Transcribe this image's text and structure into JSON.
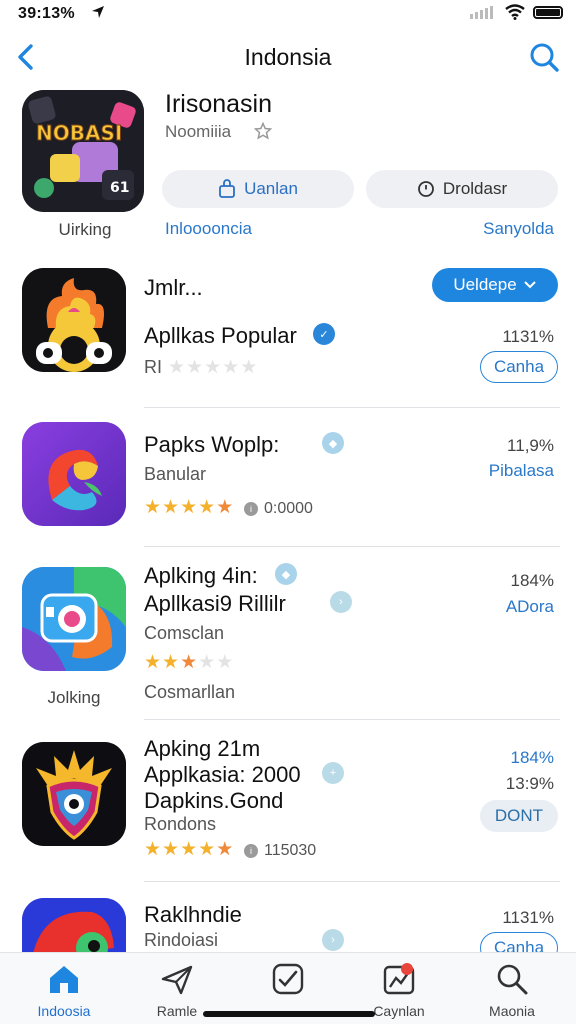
{
  "status_bar": {
    "time": "39:13%"
  },
  "nav": {
    "title": "Indonsia"
  },
  "hero": {
    "name": "Irisonasin",
    "subtitle": "Noomiiia",
    "caption": "Uirking",
    "icon_text": "NOBASI",
    "button_primary": "Uanlan",
    "button_secondary": "Droldasr",
    "link_left": "Inlooooncia",
    "link_right": "Sanyolda"
  },
  "apps": [
    {
      "title": "Jmlr...",
      "title2": "Apllkas Popular",
      "subtitle": "RI",
      "percent": "1131%",
      "action_primary": "Ueldepe",
      "action": "Canha",
      "stars": [
        0,
        0,
        0,
        0,
        0
      ],
      "accent": "#2a86d9"
    },
    {
      "title": "Papks Woplp:",
      "subtitle": "Banular",
      "percent": "11,9%",
      "side_link": "Pibalasa",
      "rating_text": "0:0000",
      "stars": [
        1,
        1,
        1,
        1,
        0.5
      ]
    },
    {
      "title": "Aplking 4in:",
      "title2": "Apllkasi9 Rillilr",
      "subtitle": "Comsclan",
      "subtitle2": "Cosmarllan",
      "caption": "Jolking",
      "percent": "184%",
      "side_link": "ADora",
      "stars": [
        1,
        1,
        0.5,
        0,
        0
      ]
    },
    {
      "title": "Apking 21m",
      "title2": "Applkasia: 2000",
      "title3": "Dapkins.Gond",
      "subtitle": "Rondons",
      "percent": "184%",
      "percent2": "13:9%",
      "action": "DONT",
      "rating_text": "115030",
      "stars": [
        1,
        1,
        1,
        1,
        0.5
      ]
    },
    {
      "title": "Raklhndie",
      "subtitle": "Rindoiasi",
      "percent": "1131%",
      "action": "Canha"
    }
  ],
  "tabs": [
    {
      "label": "Indoosia",
      "icon": "home-icon",
      "active": true
    },
    {
      "label": "Ramle",
      "icon": "paper-plane-icon"
    },
    {
      "label": "",
      "icon": "pulse-square-icon"
    },
    {
      "label": "Caynlan",
      "icon": "chart-icon",
      "badge": true
    },
    {
      "label": "Maonia",
      "icon": "search-icon"
    }
  ],
  "colors": {
    "accent": "#1f86e0",
    "link": "#2a78c9",
    "star": "#f4b22c"
  }
}
